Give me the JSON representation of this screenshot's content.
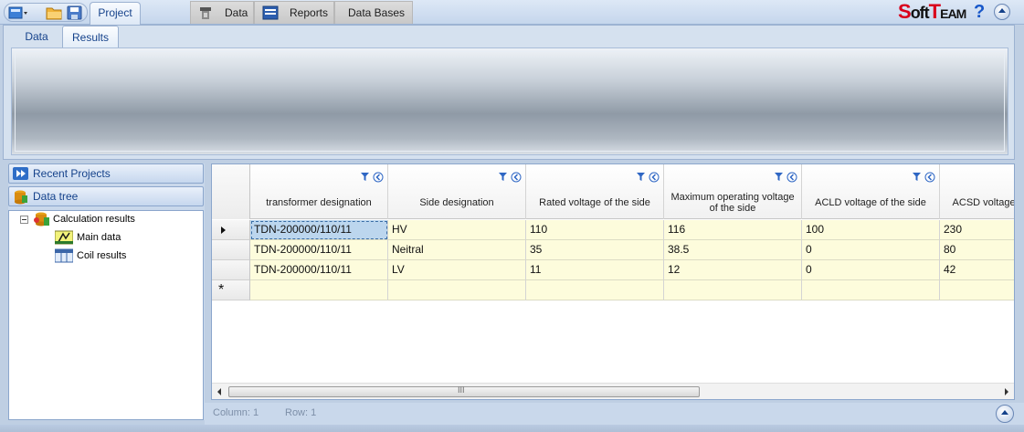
{
  "top_tabs": {
    "project": "Project",
    "data": "Data",
    "reports": "Reports",
    "data_bases": "Data Bases"
  },
  "logo": {
    "part1": "S",
    "part2": "oft",
    "part3": "T",
    "part4": "EAM"
  },
  "help_label": "?",
  "sub_tabs": {
    "data": "Data",
    "results": "Results"
  },
  "nav": {
    "recent_projects": "Recent Projects",
    "data_tree": "Data tree"
  },
  "tree": {
    "root": "Calculation results",
    "children": [
      "Main data",
      "Coil results"
    ]
  },
  "grid": {
    "columns": [
      "transformer designation",
      "Side designation",
      "Rated voltage of the side",
      "Maximum operating voltage of the side",
      "ACLD voltage of the side",
      "ACSD voltage of the side"
    ],
    "rows": [
      [
        "TDN-200000/110/11",
        "HV",
        "110",
        "116",
        "100",
        "230"
      ],
      [
        "TDN-200000/110/11",
        "Neitral",
        "35",
        "38.5",
        "0",
        "80"
      ],
      [
        "TDN-200000/110/11",
        "LV",
        "11",
        "12",
        "0",
        "42"
      ]
    ],
    "new_row_marker": "*",
    "scroll_thumb_label": "III"
  },
  "status": {
    "column": "Column: 1",
    "row": "Row: 1"
  },
  "colors": {
    "accent": "#15428b",
    "cell_bg": "#fdfcdc",
    "selected_cell": "#bcd6ee",
    "logo_red": "#d9001b"
  }
}
